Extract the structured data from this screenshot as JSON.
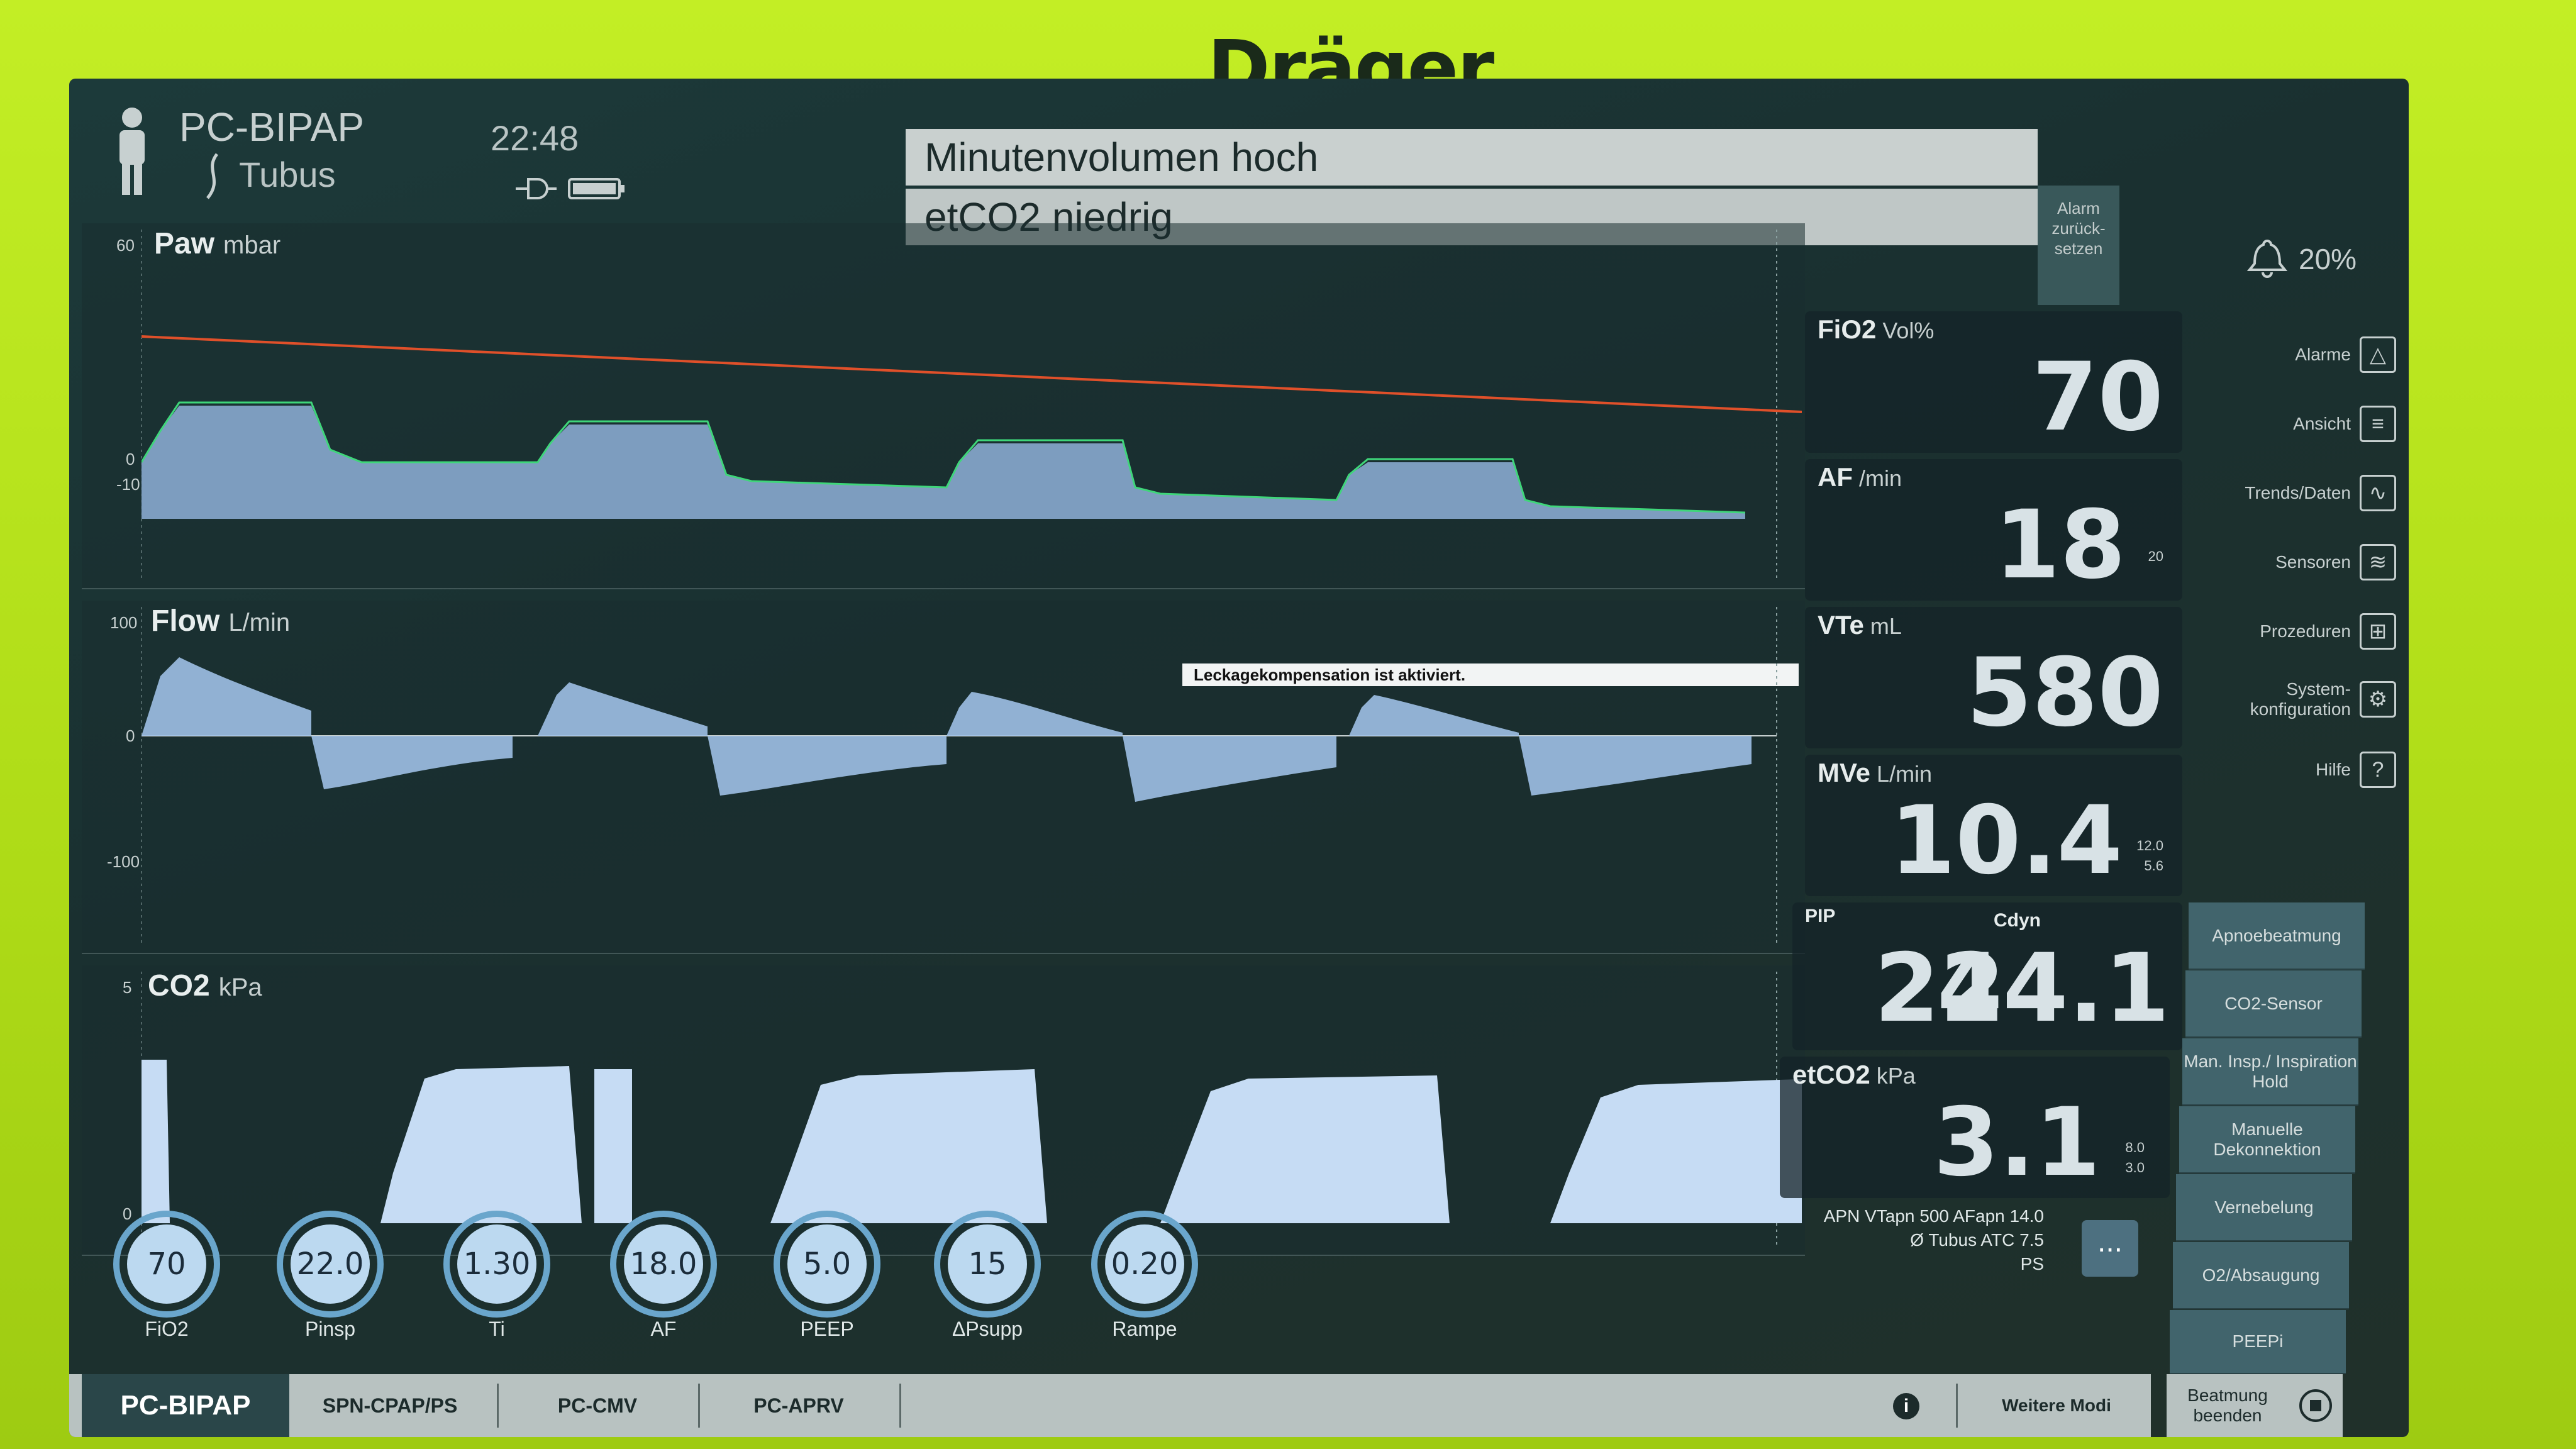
{
  "device": {
    "brand": "Dräger"
  },
  "header": {
    "mode": "PC-BIPAP",
    "airway": "Tubus",
    "time": "22:48",
    "alarms": [
      "Minutenvolumen hoch",
      "etCO2 niedrig"
    ],
    "alarm_reset": [
      "Alarm",
      "zurück-",
      "setzen"
    ],
    "o2_percent": "20%"
  },
  "waveforms": {
    "paw": {
      "label": "Paw",
      "unit": "mbar",
      "ticks": [
        "60",
        "0",
        "-10"
      ]
    },
    "flow": {
      "label": "Flow",
      "unit": "L/min",
      "ticks": [
        "100",
        "0",
        "-100"
      ],
      "notice": "Leckagekompensation ist aktiviert."
    },
    "co2": {
      "label": "CO2",
      "unit": "kPa",
      "ticks": [
        "5",
        "0"
      ]
    }
  },
  "values": {
    "fio2": {
      "label": "FiO2",
      "unit": "Vol%",
      "value": "70"
    },
    "af": {
      "label": "AF",
      "unit": "/min",
      "value": "18",
      "limit": "20"
    },
    "vte": {
      "label": "VTe",
      "unit": "mL",
      "value": "580"
    },
    "mve": {
      "label": "MVe",
      "unit": "L/min",
      "value": "10.4",
      "limit_hi": "12.0",
      "limit_lo": "5.6"
    },
    "pip": {
      "label": "PIP",
      "value": "22"
    },
    "cdyn": {
      "label": "Cdyn",
      "value": "44.1"
    },
    "etco2": {
      "label": "etCO2",
      "unit": "kPa",
      "value": "3.1",
      "limit_hi": "8.0",
      "limit_lo": "3.0"
    }
  },
  "menu": [
    {
      "label": "Alarme",
      "icon": "alarm-icon"
    },
    {
      "label": "Ansicht",
      "icon": "view-icon"
    },
    {
      "label": "Trends/Daten",
      "icon": "trends-icon"
    },
    {
      "label": "Sensoren",
      "icon": "sensors-icon"
    },
    {
      "label": "Prozeduren",
      "icon": "procedures-icon"
    },
    {
      "label": "System-\nkonfiguration",
      "icon": "system-config-icon"
    },
    {
      "label": "Hilfe",
      "icon": "help-icon"
    }
  ],
  "side_buttons": [
    "Apnoebeatmung",
    "CO2-Sensor",
    "Man. Insp./ Inspiration Hold",
    "Manuelle Dekonnektion",
    "Vernebelung",
    "O2/Absaugung",
    "PEEPi",
    "Beatmung beenden"
  ],
  "info": {
    "line1": "APN  VTapn 500  AFapn 14.0",
    "line2": "Ø Tubus ATC 7.5",
    "line3": "PS",
    "more": "..."
  },
  "knobs": [
    {
      "value": "70",
      "label": "FiO2"
    },
    {
      "value": "22.0",
      "label": "Pinsp"
    },
    {
      "value": "1.30",
      "label": "Ti"
    },
    {
      "value": "18.0",
      "label": "AF"
    },
    {
      "value": "5.0",
      "label": "PEEP"
    },
    {
      "value": "15",
      "label": "ΔPsupp"
    },
    {
      "value": "0.20",
      "label": "Rampe"
    }
  ],
  "tabs": {
    "active": "PC-BIPAP",
    "others": [
      "SPN-CPAP/PS",
      "PC-CMV",
      "PC-APRV"
    ],
    "more": "Weitere Modi",
    "info_icon": "i"
  }
}
